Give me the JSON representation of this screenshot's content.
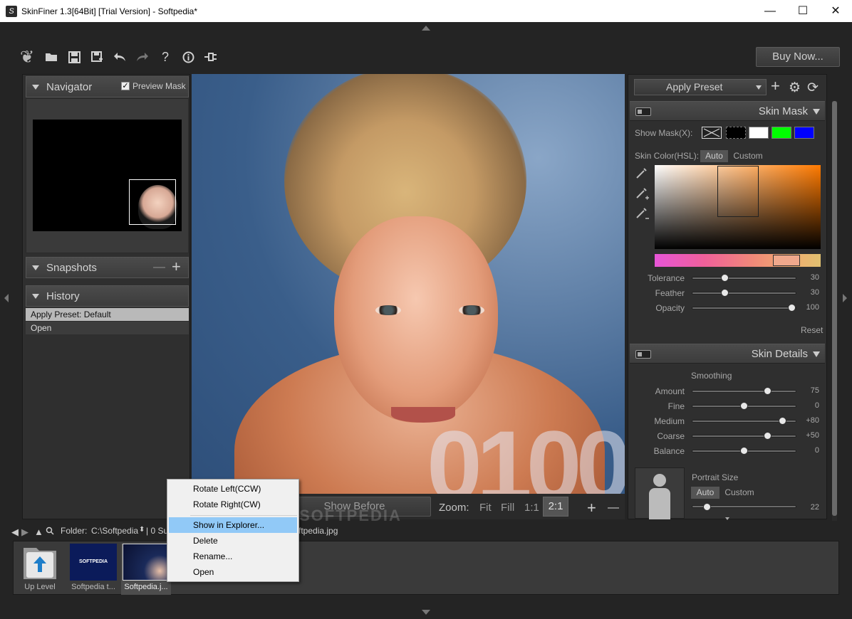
{
  "window": {
    "title": "SkinFiner 1.3[64Bit] [Trial Version] - Softpedia*",
    "minimize": "—",
    "maximize": "☐",
    "close": "✕"
  },
  "toolbar": {
    "buy_now": "Buy Now..."
  },
  "navigator": {
    "title": "Navigator",
    "preview_mask": "Preview Mask"
  },
  "snapshots": {
    "title": "Snapshots",
    "remove": "—",
    "add": "+"
  },
  "history": {
    "title": "History",
    "items": [
      "Apply Preset: Default",
      "Open"
    ]
  },
  "canvas": {
    "show_before": "Show Before",
    "zoom_label": "Zoom:",
    "zoom_fit": "Fit",
    "zoom_fill": "Fill",
    "zoom_1_1": "1:1",
    "zoom_2_1": "2:1",
    "zoom_in": "+",
    "zoom_out": "—",
    "overlay_digits": "0100"
  },
  "preset": {
    "label": "Apply Preset",
    "add": "+",
    "settings": "⚙",
    "refresh": "⟳"
  },
  "skin_mask": {
    "title": "Skin Mask",
    "show_mask_label": "Show Mask(X):",
    "skin_color_label": "Skin Color(HSL):",
    "auto": "Auto",
    "custom": "Custom",
    "sliders": [
      {
        "label": "Tolerance",
        "value": "30",
        "fraction": 0.32
      },
      {
        "label": "Feather",
        "value": "30",
        "fraction": 0.32
      },
      {
        "label": "Opacity",
        "value": "100",
        "fraction": 0.96
      }
    ],
    "reset": "Reset",
    "swatch_colors": [
      "#000000",
      "#ffffff",
      "#00ff00",
      "#0000ff"
    ]
  },
  "skin_details": {
    "title": "Skin Details",
    "smoothing_label": "Smoothing",
    "sliders": [
      {
        "label": "Amount",
        "value": "75",
        "fraction": 0.73
      },
      {
        "label": "Fine",
        "value": "0",
        "fraction": 0.5
      },
      {
        "label": "Medium",
        "value": "+80",
        "fraction": 0.87
      },
      {
        "label": "Coarse",
        "value": "+50",
        "fraction": 0.73
      },
      {
        "label": "Balance",
        "value": "0",
        "fraction": 0.5
      }
    ],
    "portrait_size_label": "Portrait Size",
    "auto": "Auto",
    "custom": "Custom",
    "portrait_value": "22",
    "portrait_fraction": 0.15
  },
  "folder": {
    "label": "Folder:",
    "path": "C:\\Softpedia",
    "info": "| 0 Su",
    "filename": "ftpedia.jpg"
  },
  "filmstrip": {
    "items": [
      {
        "label": "Up Level"
      },
      {
        "label": "Softpedia t...",
        "thumb_text": "SOFTPEDIA"
      },
      {
        "label": "Softpedia.j..."
      }
    ]
  },
  "context_menu": {
    "items": [
      "Rotate Left(CCW)",
      "Rotate Right(CW)",
      "Show in Explorer...",
      "Delete",
      "Rename...",
      "Open"
    ]
  },
  "watermark": "SOFTPEDIA"
}
